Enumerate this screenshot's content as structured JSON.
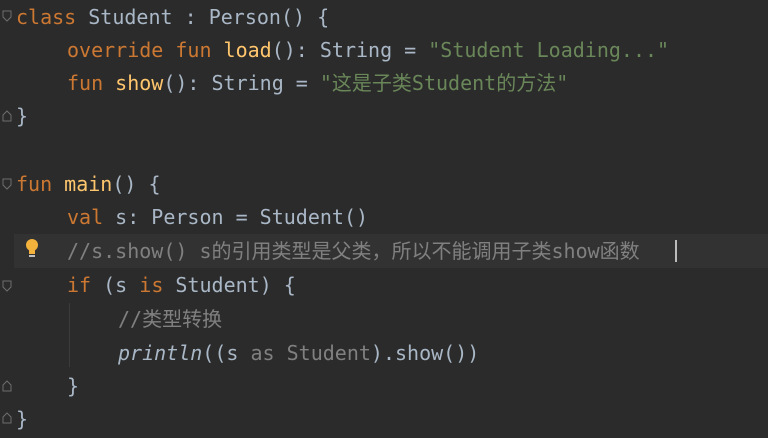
{
  "editor": {
    "lines": {
      "l1": {
        "kw": "class",
        "name": "Student",
        "colon": ":",
        "parent": "Person()",
        "brace": "{"
      },
      "l2": {
        "kw1": "override",
        "kw2": "fun",
        "fn": "load",
        "rest": "(): String =",
        "str": "\"Student Loading...\""
      },
      "l3": {
        "kw": "fun",
        "fn": "show",
        "rest": "(): String =",
        "str": "\"这是子类Student的方法\""
      },
      "l4": {
        "brace": "}"
      },
      "l6": {
        "kw": "fun",
        "fn": "main",
        "rest": "() {"
      },
      "l7": {
        "kw": "val",
        "rest": "s: Person = Student()"
      },
      "l8": {
        "comment": "//s.show() s的引用类型是父类，所以不能调用子类show函数"
      },
      "l9": {
        "kw1": "if",
        "open": "(s",
        "kw2": "is",
        "rest": "Student) {"
      },
      "l10": {
        "comment": "//类型转换"
      },
      "l11": {
        "fn": "println",
        "open": "((s",
        "kw": "as",
        "type": "Student",
        "rest": ").show())"
      },
      "l12": {
        "brace": "}"
      },
      "l13": {
        "brace": "}"
      }
    }
  },
  "colors": {
    "background": "#2b2b2b",
    "keyword": "#cc7832",
    "function": "#ffc66d",
    "string": "#6a8759",
    "comment": "#808080",
    "default_text": "#a9b7c6"
  }
}
